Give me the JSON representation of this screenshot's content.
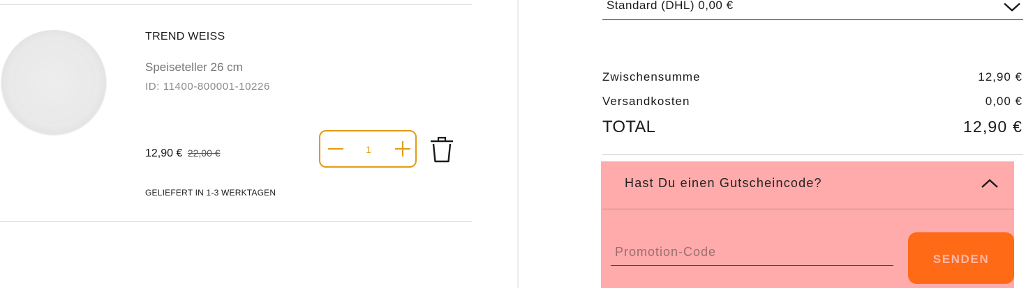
{
  "cart_item": {
    "name": "TREND WEISS",
    "description": "Speiseteller 26 cm",
    "id_text": "ID: 11400-800001-10226",
    "price": "12,90 €",
    "old_price": "22,00 €",
    "delivery": "GELIEFERT IN 1-3 WERKTAGEN",
    "quantity": "1",
    "image_icon": "plate-image",
    "accent_color": "#e39a16"
  },
  "shipping": {
    "selected_option": "Standard (DHL) 0,00 €"
  },
  "summary": {
    "subtotal_label": "Zwischensumme",
    "subtotal_value": "12,90 €",
    "shipping_label": "Versandkosten",
    "shipping_value": "0,00 €",
    "total_label": "TOTAL",
    "total_value": "12,90 €"
  },
  "promo": {
    "title": "Hast Du einen Gutscheincode?",
    "placeholder": "Promotion-Code",
    "value": "",
    "send_label": "SENDEN",
    "background_color": "#ffabab",
    "button_color": "#fe6a16"
  }
}
